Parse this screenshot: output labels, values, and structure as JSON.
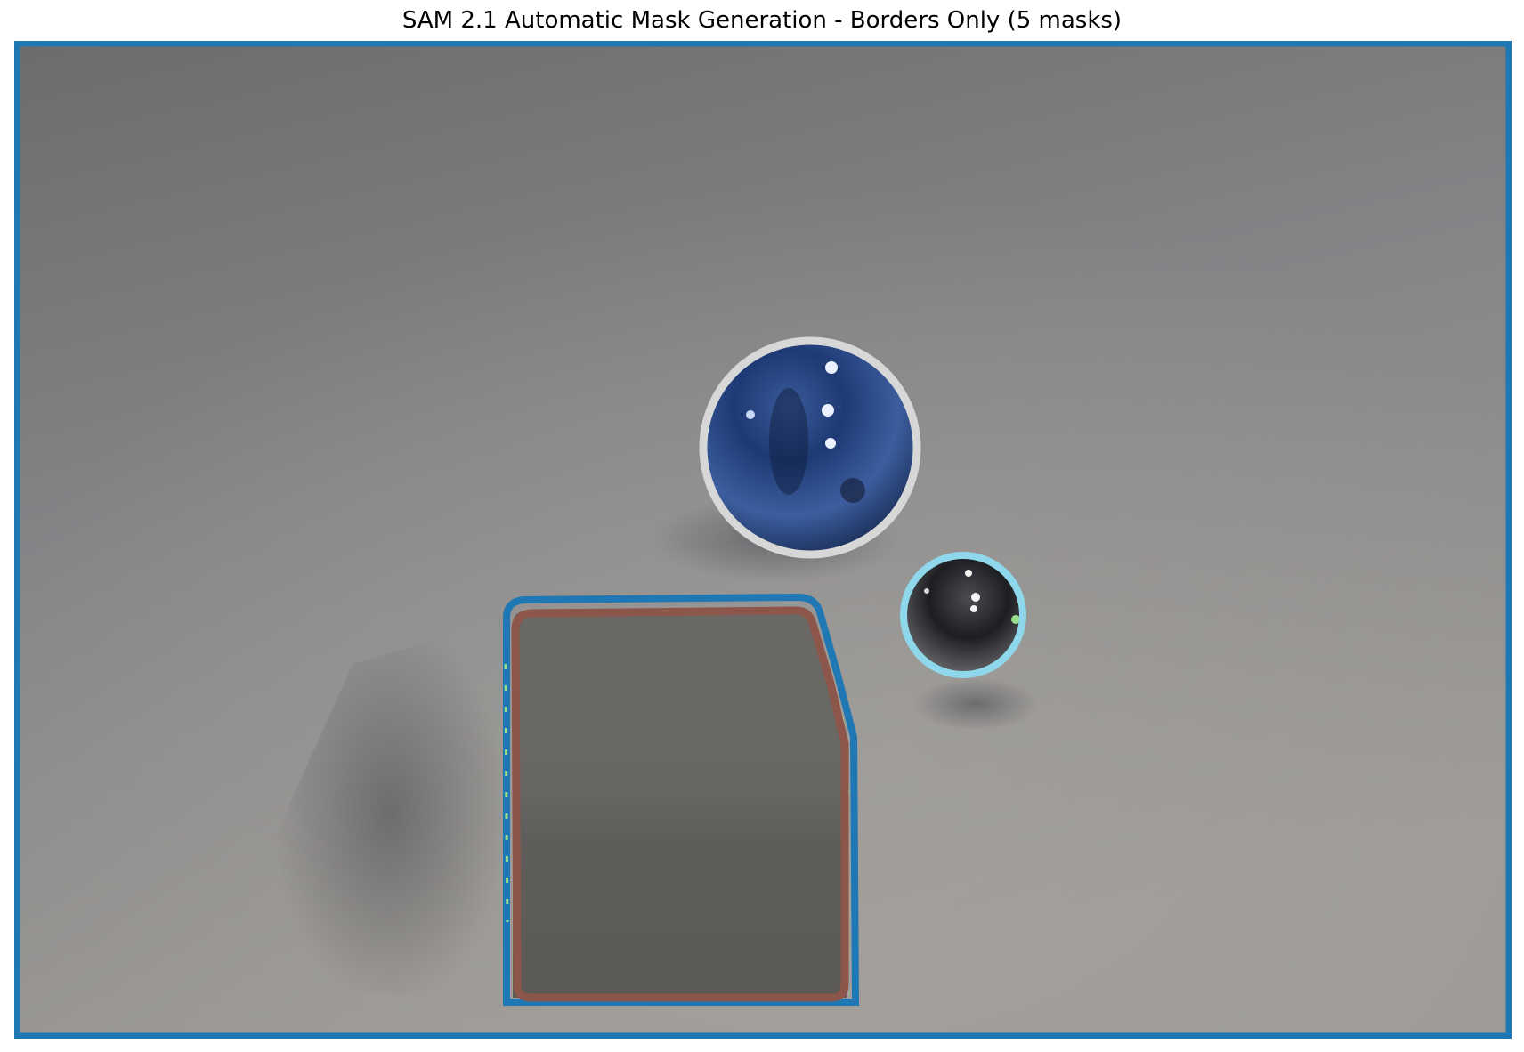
{
  "title": "SAM 2.1 Automatic Mask Generation - Borders Only (5 masks)",
  "image": {
    "subject": "rendered scene: large blue metallic sphere, small dark metallic sphere and a grey cube on a grey floor"
  },
  "masks": [
    {
      "name": "background",
      "color": "#1f77b4"
    },
    {
      "name": "cube",
      "color": "#8c564b"
    },
    {
      "name": "cube-fragments",
      "color": "#98df8a"
    },
    {
      "name": "large-sphere",
      "color": "#d7d7d7"
    },
    {
      "name": "small-sphere",
      "color": "#8fd8ec"
    }
  ]
}
